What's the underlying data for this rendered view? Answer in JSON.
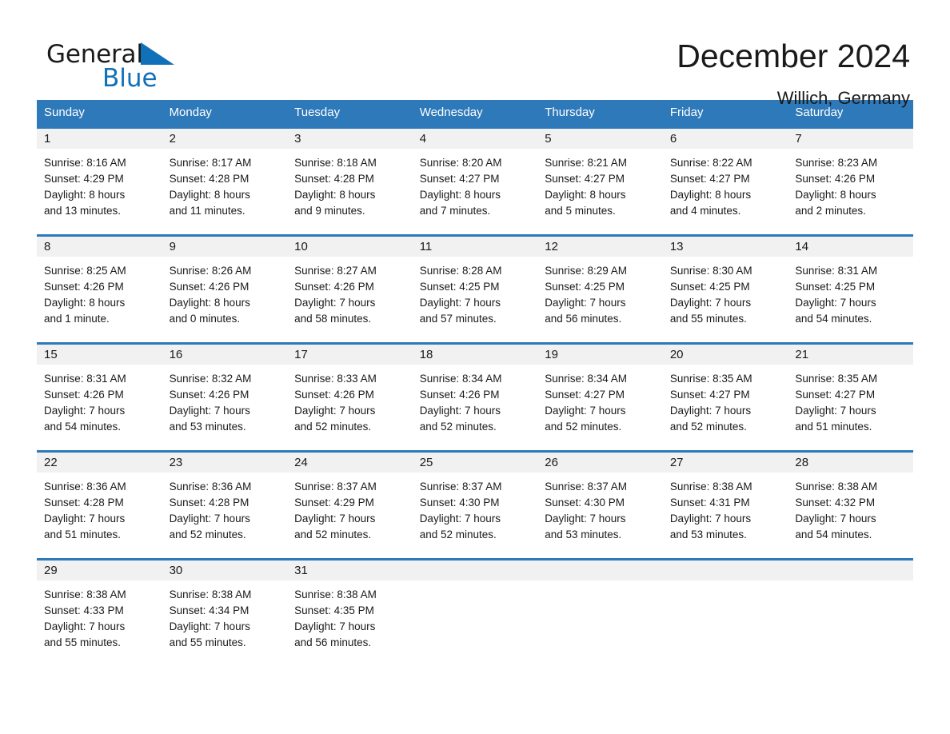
{
  "brand": {
    "name_part1": "General",
    "name_part2": "Blue",
    "accent_color": "#1071b8"
  },
  "header": {
    "month_title": "December 2024",
    "location": "Willich, Germany"
  },
  "theme": {
    "header_blue": "#2e79b9",
    "daynum_band": "#f1f1f1",
    "text": "#1a1a1a"
  },
  "weekday_headers": [
    "Sunday",
    "Monday",
    "Tuesday",
    "Wednesday",
    "Thursday",
    "Friday",
    "Saturday"
  ],
  "weeks": [
    [
      {
        "day": "1",
        "sunrise": "Sunrise: 8:16 AM",
        "sunset": "Sunset: 4:29 PM",
        "daylight_line1": "Daylight: 8 hours",
        "daylight_line2": "and 13 minutes."
      },
      {
        "day": "2",
        "sunrise": "Sunrise: 8:17 AM",
        "sunset": "Sunset: 4:28 PM",
        "daylight_line1": "Daylight: 8 hours",
        "daylight_line2": "and 11 minutes."
      },
      {
        "day": "3",
        "sunrise": "Sunrise: 8:18 AM",
        "sunset": "Sunset: 4:28 PM",
        "daylight_line1": "Daylight: 8 hours",
        "daylight_line2": "and 9 minutes."
      },
      {
        "day": "4",
        "sunrise": "Sunrise: 8:20 AM",
        "sunset": "Sunset: 4:27 PM",
        "daylight_line1": "Daylight: 8 hours",
        "daylight_line2": "and 7 minutes."
      },
      {
        "day": "5",
        "sunrise": "Sunrise: 8:21 AM",
        "sunset": "Sunset: 4:27 PM",
        "daylight_line1": "Daylight: 8 hours",
        "daylight_line2": "and 5 minutes."
      },
      {
        "day": "6",
        "sunrise": "Sunrise: 8:22 AM",
        "sunset": "Sunset: 4:27 PM",
        "daylight_line1": "Daylight: 8 hours",
        "daylight_line2": "and 4 minutes."
      },
      {
        "day": "7",
        "sunrise": "Sunrise: 8:23 AM",
        "sunset": "Sunset: 4:26 PM",
        "daylight_line1": "Daylight: 8 hours",
        "daylight_line2": "and 2 minutes."
      }
    ],
    [
      {
        "day": "8",
        "sunrise": "Sunrise: 8:25 AM",
        "sunset": "Sunset: 4:26 PM",
        "daylight_line1": "Daylight: 8 hours",
        "daylight_line2": "and 1 minute."
      },
      {
        "day": "9",
        "sunrise": "Sunrise: 8:26 AM",
        "sunset": "Sunset: 4:26 PM",
        "daylight_line1": "Daylight: 8 hours",
        "daylight_line2": "and 0 minutes."
      },
      {
        "day": "10",
        "sunrise": "Sunrise: 8:27 AM",
        "sunset": "Sunset: 4:26 PM",
        "daylight_line1": "Daylight: 7 hours",
        "daylight_line2": "and 58 minutes."
      },
      {
        "day": "11",
        "sunrise": "Sunrise: 8:28 AM",
        "sunset": "Sunset: 4:25 PM",
        "daylight_line1": "Daylight: 7 hours",
        "daylight_line2": "and 57 minutes."
      },
      {
        "day": "12",
        "sunrise": "Sunrise: 8:29 AM",
        "sunset": "Sunset: 4:25 PM",
        "daylight_line1": "Daylight: 7 hours",
        "daylight_line2": "and 56 minutes."
      },
      {
        "day": "13",
        "sunrise": "Sunrise: 8:30 AM",
        "sunset": "Sunset: 4:25 PM",
        "daylight_line1": "Daylight: 7 hours",
        "daylight_line2": "and 55 minutes."
      },
      {
        "day": "14",
        "sunrise": "Sunrise: 8:31 AM",
        "sunset": "Sunset: 4:25 PM",
        "daylight_line1": "Daylight: 7 hours",
        "daylight_line2": "and 54 minutes."
      }
    ],
    [
      {
        "day": "15",
        "sunrise": "Sunrise: 8:31 AM",
        "sunset": "Sunset: 4:26 PM",
        "daylight_line1": "Daylight: 7 hours",
        "daylight_line2": "and 54 minutes."
      },
      {
        "day": "16",
        "sunrise": "Sunrise: 8:32 AM",
        "sunset": "Sunset: 4:26 PM",
        "daylight_line1": "Daylight: 7 hours",
        "daylight_line2": "and 53 minutes."
      },
      {
        "day": "17",
        "sunrise": "Sunrise: 8:33 AM",
        "sunset": "Sunset: 4:26 PM",
        "daylight_line1": "Daylight: 7 hours",
        "daylight_line2": "and 52 minutes."
      },
      {
        "day": "18",
        "sunrise": "Sunrise: 8:34 AM",
        "sunset": "Sunset: 4:26 PM",
        "daylight_line1": "Daylight: 7 hours",
        "daylight_line2": "and 52 minutes."
      },
      {
        "day": "19",
        "sunrise": "Sunrise: 8:34 AM",
        "sunset": "Sunset: 4:27 PM",
        "daylight_line1": "Daylight: 7 hours",
        "daylight_line2": "and 52 minutes."
      },
      {
        "day": "20",
        "sunrise": "Sunrise: 8:35 AM",
        "sunset": "Sunset: 4:27 PM",
        "daylight_line1": "Daylight: 7 hours",
        "daylight_line2": "and 52 minutes."
      },
      {
        "day": "21",
        "sunrise": "Sunrise: 8:35 AM",
        "sunset": "Sunset: 4:27 PM",
        "daylight_line1": "Daylight: 7 hours",
        "daylight_line2": "and 51 minutes."
      }
    ],
    [
      {
        "day": "22",
        "sunrise": "Sunrise: 8:36 AM",
        "sunset": "Sunset: 4:28 PM",
        "daylight_line1": "Daylight: 7 hours",
        "daylight_line2": "and 51 minutes."
      },
      {
        "day": "23",
        "sunrise": "Sunrise: 8:36 AM",
        "sunset": "Sunset: 4:28 PM",
        "daylight_line1": "Daylight: 7 hours",
        "daylight_line2": "and 52 minutes."
      },
      {
        "day": "24",
        "sunrise": "Sunrise: 8:37 AM",
        "sunset": "Sunset: 4:29 PM",
        "daylight_line1": "Daylight: 7 hours",
        "daylight_line2": "and 52 minutes."
      },
      {
        "day": "25",
        "sunrise": "Sunrise: 8:37 AM",
        "sunset": "Sunset: 4:30 PM",
        "daylight_line1": "Daylight: 7 hours",
        "daylight_line2": "and 52 minutes."
      },
      {
        "day": "26",
        "sunrise": "Sunrise: 8:37 AM",
        "sunset": "Sunset: 4:30 PM",
        "daylight_line1": "Daylight: 7 hours",
        "daylight_line2": "and 53 minutes."
      },
      {
        "day": "27",
        "sunrise": "Sunrise: 8:38 AM",
        "sunset": "Sunset: 4:31 PM",
        "daylight_line1": "Daylight: 7 hours",
        "daylight_line2": "and 53 minutes."
      },
      {
        "day": "28",
        "sunrise": "Sunrise: 8:38 AM",
        "sunset": "Sunset: 4:32 PM",
        "daylight_line1": "Daylight: 7 hours",
        "daylight_line2": "and 54 minutes."
      }
    ],
    [
      {
        "day": "29",
        "sunrise": "Sunrise: 8:38 AM",
        "sunset": "Sunset: 4:33 PM",
        "daylight_line1": "Daylight: 7 hours",
        "daylight_line2": "and 55 minutes."
      },
      {
        "day": "30",
        "sunrise": "Sunrise: 8:38 AM",
        "sunset": "Sunset: 4:34 PM",
        "daylight_line1": "Daylight: 7 hours",
        "daylight_line2": "and 55 minutes."
      },
      {
        "day": "31",
        "sunrise": "Sunrise: 8:38 AM",
        "sunset": "Sunset: 4:35 PM",
        "daylight_line1": "Daylight: 7 hours",
        "daylight_line2": "and 56 minutes."
      },
      {
        "day": "",
        "sunrise": "",
        "sunset": "",
        "daylight_line1": "",
        "daylight_line2": ""
      },
      {
        "day": "",
        "sunrise": "",
        "sunset": "",
        "daylight_line1": "",
        "daylight_line2": ""
      },
      {
        "day": "",
        "sunrise": "",
        "sunset": "",
        "daylight_line1": "",
        "daylight_line2": ""
      },
      {
        "day": "",
        "sunrise": "",
        "sunset": "",
        "daylight_line1": "",
        "daylight_line2": ""
      }
    ]
  ]
}
